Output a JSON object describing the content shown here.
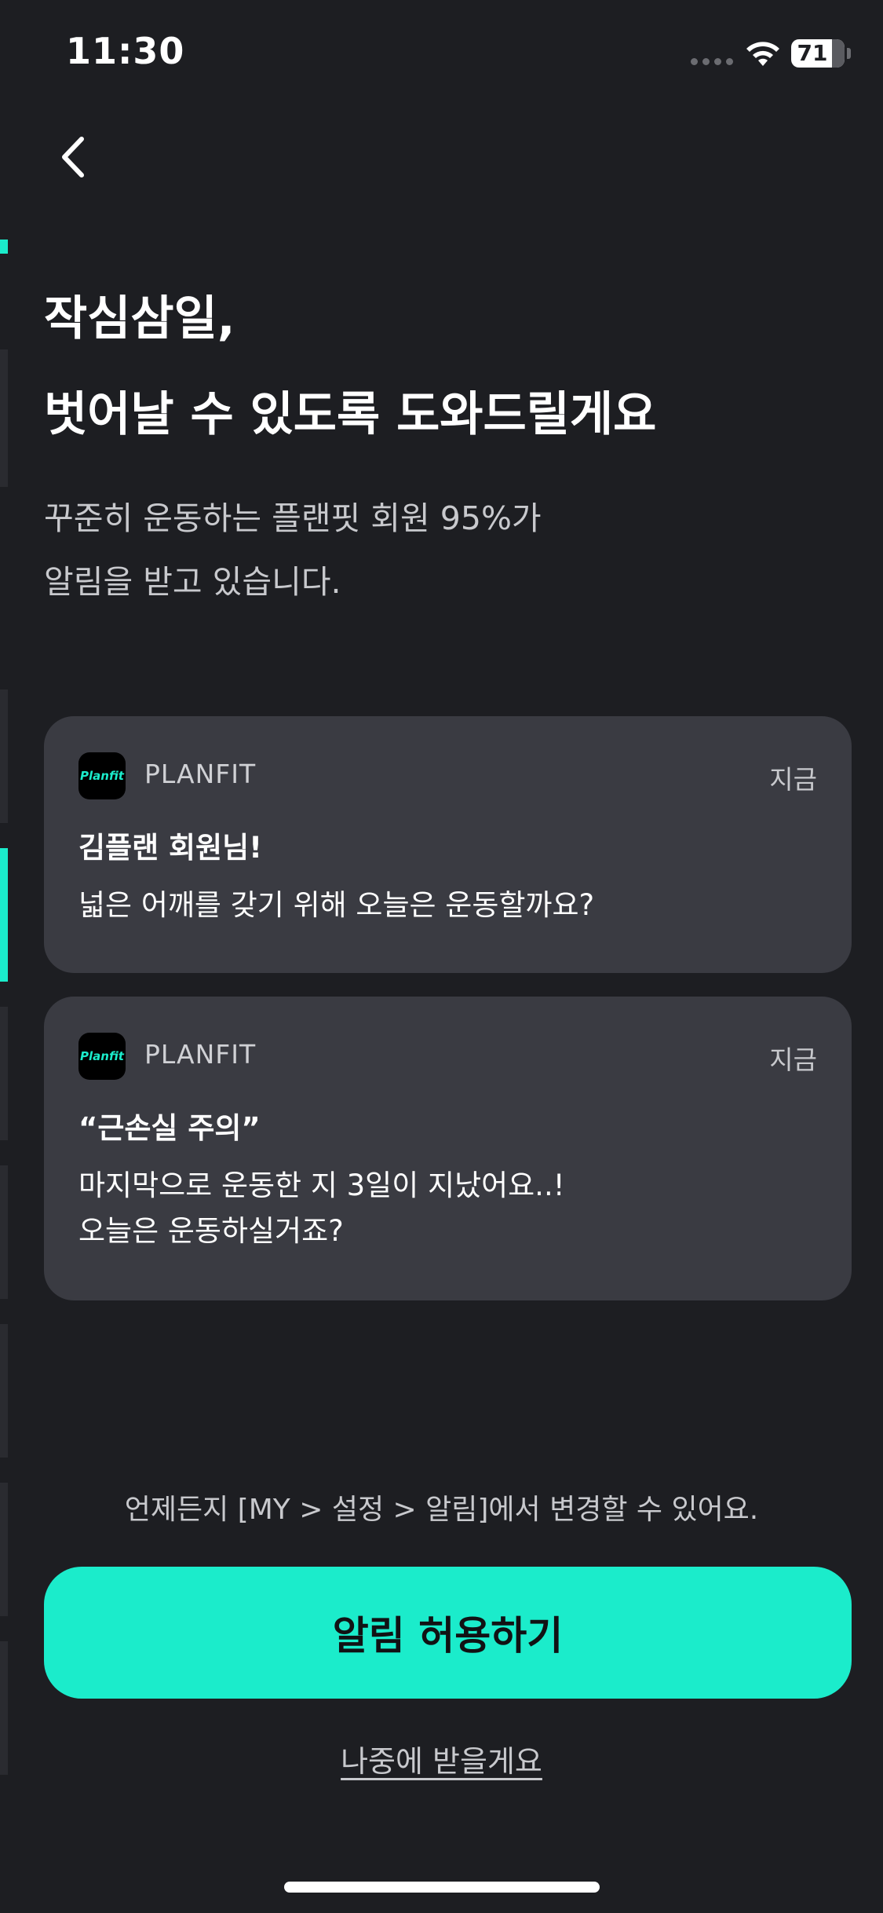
{
  "status_bar": {
    "time": "11:30",
    "battery": "71",
    "battery_level": 0.71
  },
  "icons": {
    "back": "chevron-left-icon",
    "wifi": "wifi-icon",
    "battery": "battery-icon",
    "app": "planfit-app-icon"
  },
  "colors": {
    "background": "#1d1e22",
    "card": "#3a3b42",
    "accent": "#1beccb"
  },
  "headline": {
    "line1": "작심삼일,",
    "line2": "벗어날 수 있도록 도와드릴게요"
  },
  "subtitle": {
    "line1": "꾸준히 운동하는 플랜핏 회원 95%가",
    "line2": "알림을 받고 있습니다."
  },
  "notifications": [
    {
      "app_icon_text": "Planfit",
      "app_name": "PLANFIT",
      "time": "지금",
      "title": "김플랜 회원님!",
      "body": [
        "넓은 어깨를 갖기 위해 오늘은 운동할까요?"
      ]
    },
    {
      "app_icon_text": "Planfit",
      "app_name": "PLANFIT",
      "time": "지금",
      "title": "“근손실 주의”",
      "body": [
        "마지막으로 운동한 지 3일이 지났어요..!",
        "오늘은 운동하실거죠?"
      ]
    }
  ],
  "settings_hint": "언제든지 [MY > 설정 > 알림]에서 변경할 수 있어요.",
  "allow_button_label": "알림 허용하기",
  "later_link_label": "나중에 받을게요"
}
